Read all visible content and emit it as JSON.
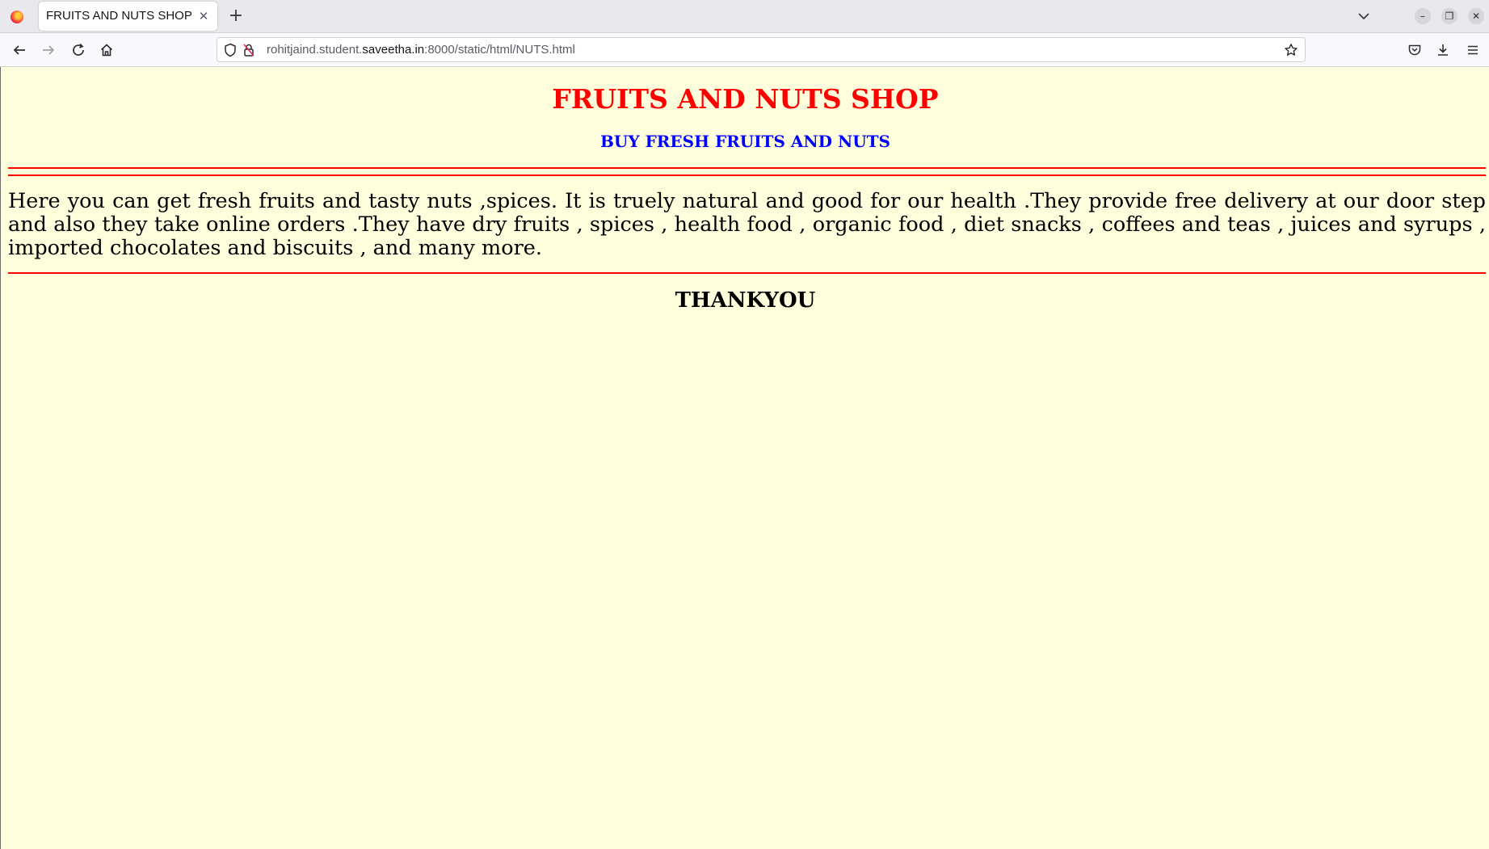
{
  "browser": {
    "tab_title": "FRUITS AND NUTS SHOP",
    "url_prefix": "rohitjaind.student.",
    "url_host": "saveetha.in",
    "url_suffix": ":8000/static/html/NUTS.html",
    "icons": [
      "firefox-icon",
      "close-icon",
      "plus-icon",
      "chevron-down-icon",
      "minimize-icon",
      "restore-icon",
      "close-window-icon",
      "back-arrow-icon",
      "forward-arrow-icon",
      "reload-icon",
      "home-icon",
      "shield-icon",
      "insecure-lock-icon",
      "star-icon",
      "pocket-icon",
      "download-icon",
      "hamburger-menu-icon"
    ]
  },
  "page": {
    "title": "FRUITS AND NUTS SHOP",
    "subtitle": "BUY FRESH FRUITS AND NUTS",
    "body": "Here you can get fresh fruits and tasty nuts ,spices. It is truely natural and good for our health .They provide free delivery at our door step and also they take online orders .They have dry fruits , spices , health food , organic food , diet snacks , coffees and teas , juices and syrups , imported chocolates and biscuits , and many more.",
    "thanks": "THANKYOU"
  },
  "colors": {
    "background": "#fffedc",
    "title": "#ff0000",
    "subtitle": "#0000ff",
    "rule": "#ff0000"
  }
}
